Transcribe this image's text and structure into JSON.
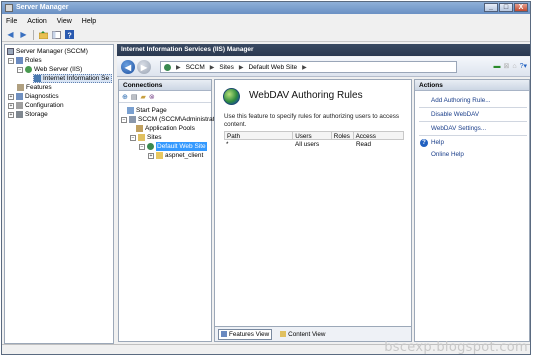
{
  "window": {
    "title": "Server Manager",
    "buttons": {
      "minimize": "_",
      "maximize": "□",
      "close": "X"
    }
  },
  "menu": [
    "File",
    "Action",
    "View",
    "Help"
  ],
  "tree": {
    "root": "Server Manager (SCCM)",
    "roles": "Roles",
    "web_server": "Web Server (IIS)",
    "iis_manager": "Internet Information Se",
    "features": "Features",
    "diagnostics": "Diagnostics",
    "configuration": "Configuration",
    "storage": "Storage"
  },
  "iis": {
    "title": "Internet Information Services (IIS) Manager",
    "breadcrumb": [
      "SCCM",
      "Sites",
      "Default Web Site"
    ]
  },
  "connections": {
    "header": "Connections",
    "start_page": "Start Page",
    "server": "SCCM (SCCM\\Administrat",
    "app_pools": "Application Pools",
    "sites": "Sites",
    "default_site": "Default Web Site",
    "aspnet_client": "aspnet_client"
  },
  "feature": {
    "title": "WebDAV Authoring Rules",
    "description": "Use this feature to specify rules for authorizing users to access content.",
    "columns": [
      "Path",
      "Users",
      "Roles",
      "Access"
    ],
    "rows": [
      {
        "path": "*",
        "users": "All users",
        "roles": "",
        "access": "Read"
      }
    ]
  },
  "views": {
    "features": "Features View",
    "content": "Content View"
  },
  "actions": {
    "header": "Actions",
    "add_rule": "Add Authoring Rule...",
    "disable": "Disable WebDAV",
    "settings": "WebDAV Settings...",
    "help": "Help",
    "online_help": "Online Help"
  },
  "watermark": "bscexp.blogspot.com",
  "colors": {
    "title_bar": "#6a90c4",
    "iis_header": "#2a3850",
    "link": "#1a3e8a",
    "selection": "#3399ff"
  }
}
